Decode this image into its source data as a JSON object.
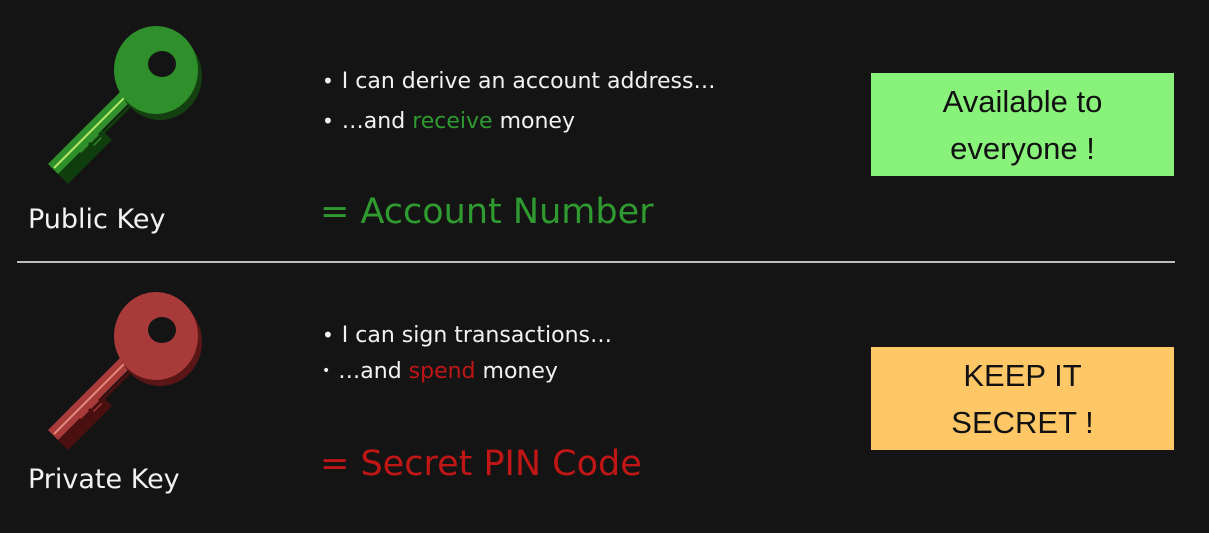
{
  "public": {
    "label": "Public Key",
    "bullet1": "I can derive an account address…",
    "bullet2_pre": "…and ",
    "bullet2_highlight": "receive",
    "bullet2_post": " money",
    "equation": "= Account Number",
    "callout": "Available to\neveryone !",
    "key_color": "#2f8f2a",
    "callout_color": "#88f27a"
  },
  "private": {
    "label": "Private Key",
    "bullet1": "I can sign transactions…",
    "bullet2_pre": "…and ",
    "bullet2_highlight": "spend",
    "bullet2_post": " money",
    "equation": "= Secret PIN Code",
    "callout": "KEEP IT\nSECRET !",
    "key_color": "#a83a3a",
    "callout_color": "#ffc766"
  },
  "bullet_char": "•"
}
